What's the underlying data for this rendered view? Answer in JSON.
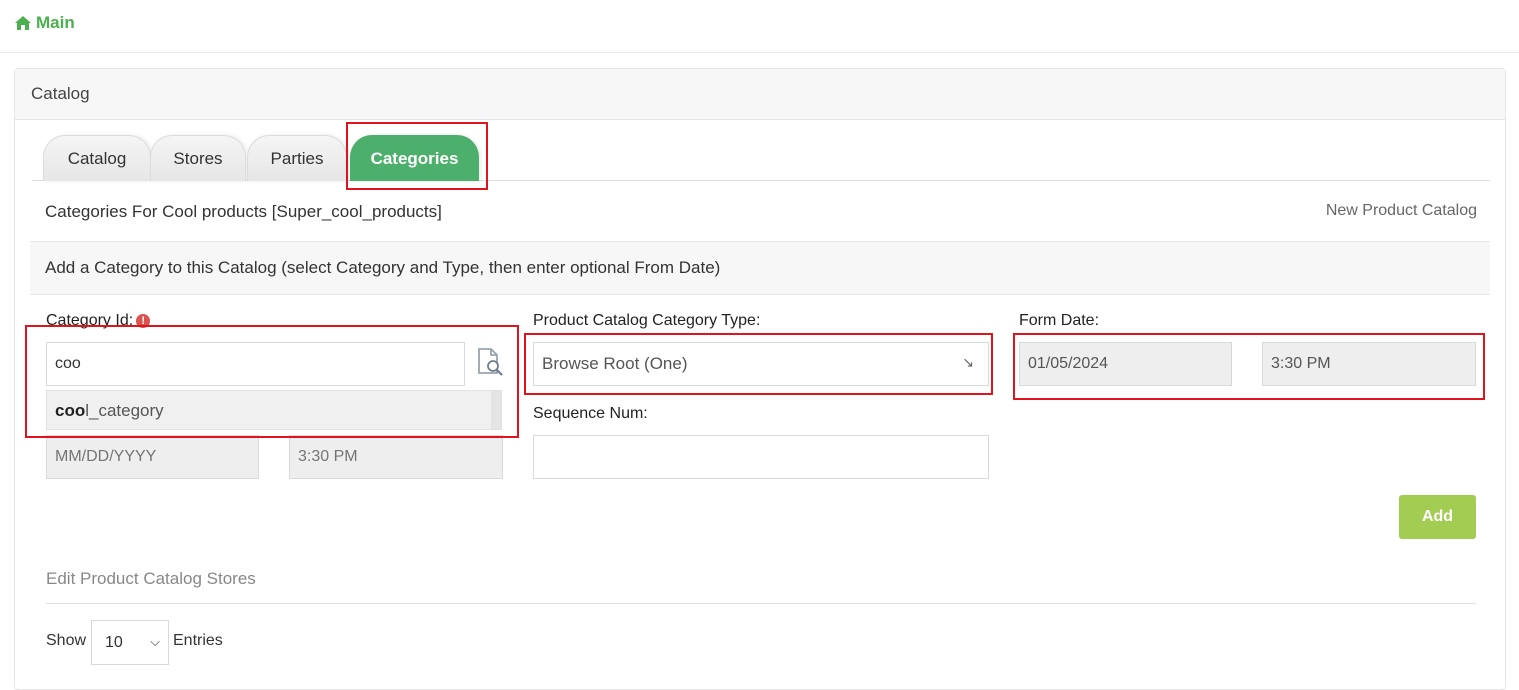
{
  "breadcrumb": {
    "home_label": "Main"
  },
  "panel": {
    "title": "Catalog"
  },
  "tabs": [
    {
      "label": "Catalog"
    },
    {
      "label": "Stores"
    },
    {
      "label": "Parties"
    },
    {
      "label": "Categories",
      "active": true
    }
  ],
  "section": {
    "title": "Categories For Cool products [Super_cool_products]",
    "new_link": "New Product Catalog",
    "add_heading": "Add a Category to this Catalog (select Category and Type, then enter optional From Date)"
  },
  "form": {
    "category_id_label": "Category Id:",
    "category_id_value": "coo",
    "suggestion_match": "coo",
    "suggestion_rest": "l_category",
    "from_date_placeholder": "MM/DD/YYYY",
    "from_time_placeholder": "3:30 PM",
    "type_label": "Product Catalog Category Type:",
    "type_value": "Browse Root (One)",
    "sequence_label": "Sequence Num:",
    "sequence_value": "",
    "form_date_label": "Form Date:",
    "form_date_value": "01/05/2024",
    "form_time_value": "3:30 PM",
    "add_button": "Add"
  },
  "stores": {
    "title": "Edit Product Catalog Stores",
    "show_label": "Show",
    "entries_value": "10",
    "entries_label": "Entries"
  },
  "colors": {
    "accent": "#4caf6b",
    "add_button": "#a3cc53",
    "highlight": "#e0141e",
    "required": "#d9534f"
  }
}
